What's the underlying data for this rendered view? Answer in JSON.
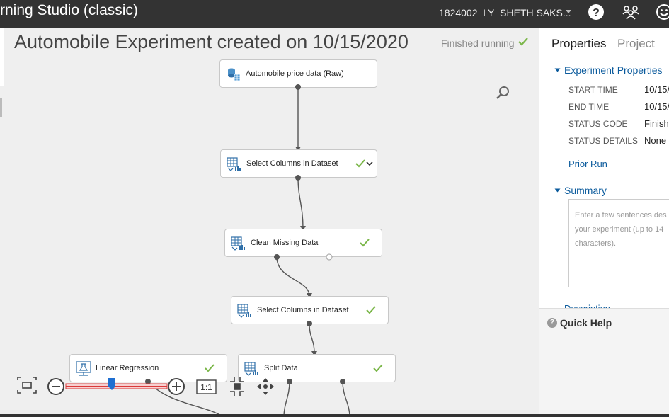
{
  "topbar": {
    "app_title": "rning Studio (classic)",
    "account": "1824002_LY_SHETH SAKS...",
    "icons": [
      "help-icon",
      "community-icon",
      "feedback-smiley-icon"
    ]
  },
  "experiment": {
    "title": "Automobile Experiment created on 10/15/2020",
    "status": "Finished running",
    "status_color": "#7ab648"
  },
  "modules": [
    {
      "label": "Automobile price data (Raw)",
      "icon": "dataset-icon",
      "finished": false
    },
    {
      "label": "Select Columns in Dataset",
      "icon": "table-module-icon",
      "finished": true
    },
    {
      "label": "Clean Missing Data",
      "icon": "table-module-icon",
      "finished": true
    },
    {
      "label": "Select Columns in Dataset",
      "icon": "table-module-icon",
      "finished": true
    },
    {
      "label": "Split Data",
      "icon": "table-module-icon",
      "finished": true
    },
    {
      "label": "Linear Regression",
      "icon": "flask-module-icon",
      "finished": true
    }
  ],
  "zoom_controls": {
    "one_to_one_label": "1:1",
    "icons": [
      "fit-to-screen-icon",
      "zoom-out-icon",
      "zoom-slider",
      "zoom-in-icon",
      "actual-size-icon",
      "minimap-icon",
      "pan-icon"
    ]
  },
  "panel": {
    "tabs": [
      "Properties",
      "Project"
    ],
    "experiment_properties": {
      "heading": "Experiment Properties",
      "rows": [
        {
          "key": "START TIME",
          "value": "10/15/"
        },
        {
          "key": "END TIME",
          "value": "10/15/"
        },
        {
          "key": "STATUS CODE",
          "value": "Finishe"
        },
        {
          "key": "STATUS DETAILS",
          "value": "None"
        }
      ],
      "prior_run": "Prior Run"
    },
    "summary": {
      "heading": "Summary",
      "placeholder": "Enter a few sentences des\nyour experiment (up to 14\ncharacters)."
    },
    "description_heading": "Description",
    "quick_help": "Quick Help"
  },
  "colors": {
    "topbar": "#333333",
    "canvas": "#efefef",
    "link": "#0a5a9c",
    "check": "#7ab648",
    "slider_thumb": "#1f6fd1"
  }
}
